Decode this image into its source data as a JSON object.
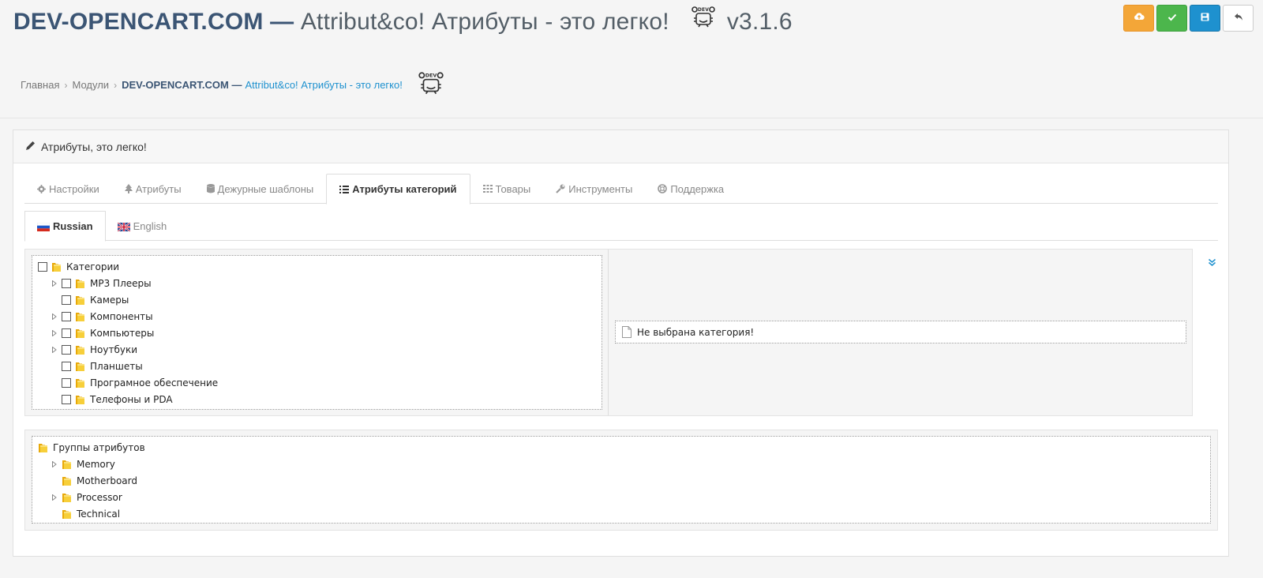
{
  "header": {
    "brand": "DEV-OPENCART.COM",
    "dash": " — ",
    "tagline": "Attribut&co! Атрибуты - это легко!",
    "version": "v3.1.6",
    "logo_text": "DEV"
  },
  "actions": [
    {
      "name": "upload",
      "icon": "cloud-upload-icon",
      "color": "#f3a638"
    },
    {
      "name": "apply",
      "icon": "check-icon",
      "color": "#4cb64c"
    },
    {
      "name": "save",
      "icon": "save-icon",
      "color": "#1e91cf"
    },
    {
      "name": "back",
      "icon": "reply-icon",
      "color": "#ffffff"
    }
  ],
  "breadcrumb": {
    "home": "Главная",
    "modules": "Модули",
    "current_brand": "DEV-OPENCART.COM —",
    "current_rest": "Attribut&co! Атрибуты - это легко!"
  },
  "panel": {
    "title": "Атрибуты, это легко!"
  },
  "tabs": [
    {
      "label": "Настройки",
      "icon": "gear-icon"
    },
    {
      "label": "Атрибуты",
      "icon": "tree-icon"
    },
    {
      "label": "Дежурные шаблоны",
      "icon": "database-icon"
    },
    {
      "label": "Атрибуты категорий",
      "icon": "list-icon",
      "active": true
    },
    {
      "label": "Товары",
      "icon": "grid-icon"
    },
    {
      "label": "Инструменты",
      "icon": "wrench-icon"
    },
    {
      "label": "Поддержка",
      "icon": "lifebuoy-icon"
    }
  ],
  "languages": [
    {
      "label": "Russian",
      "active": true,
      "icon": "russian-flag-icon"
    },
    {
      "label": "English",
      "active": false,
      "icon": "english-flag-icon"
    }
  ],
  "category_tree": {
    "root": "Категории",
    "items": [
      {
        "label": "MP3 Плееры",
        "expandable": true
      },
      {
        "label": "Камеры",
        "expandable": false
      },
      {
        "label": "Компоненты",
        "expandable": true
      },
      {
        "label": "Компьютеры",
        "expandable": true
      },
      {
        "label": "Ноутбуки",
        "expandable": true
      },
      {
        "label": "Планшеты",
        "expandable": false
      },
      {
        "label": "Програмное обеспечение",
        "expandable": false
      },
      {
        "label": "Телефоны и PDA",
        "expandable": false
      }
    ]
  },
  "no_category_message": "Не выбрана категория!",
  "attribute_tree": {
    "root": "Группы атрибутов",
    "items": [
      {
        "label": "Memory",
        "expandable": true
      },
      {
        "label": "Motherboard",
        "expandable": false
      },
      {
        "label": "Processor",
        "expandable": true
      },
      {
        "label": "Technical",
        "expandable": false
      }
    ]
  },
  "colors": {
    "brand": "#3b5574",
    "link": "#1e91cf",
    "folder": "#f5c12e"
  }
}
